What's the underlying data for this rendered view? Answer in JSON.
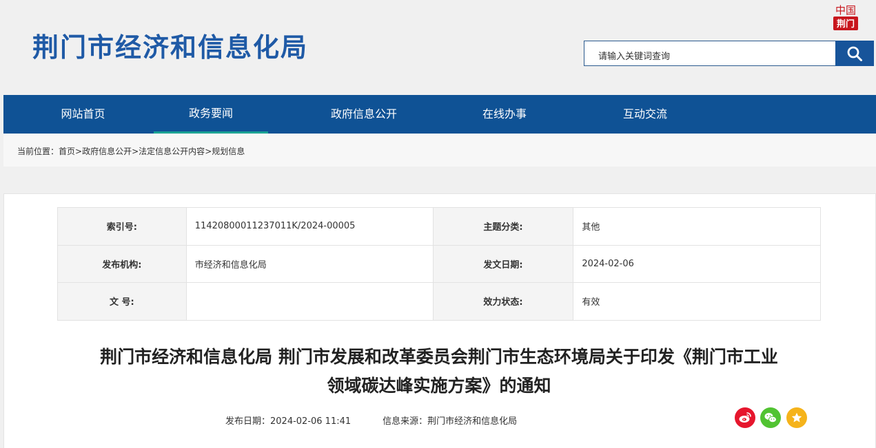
{
  "header": {
    "site_title": "荆门市经济和信息化局",
    "seal": {
      "top_text": "中国",
      "bottom_text": "荆门"
    },
    "search": {
      "placeholder": "请输入关键词查询"
    }
  },
  "nav": {
    "items": [
      {
        "label": "网站首页"
      },
      {
        "label": "政务要闻"
      },
      {
        "label": "政府信息公开"
      },
      {
        "label": "在线办事"
      },
      {
        "label": "互动交流"
      }
    ],
    "active_index": 1
  },
  "breadcrumb": {
    "prefix": "当前位置：",
    "items": [
      "首页",
      "政府信息公开",
      "法定信息公开内容",
      "规划信息"
    ],
    "separator": ">"
  },
  "meta": {
    "index_label": "索引号:",
    "index_value": "11420800011237011K/2024-00005",
    "topic_label": "主题分类:",
    "topic_value": "其他",
    "org_label": "发布机构:",
    "org_value": "市经济和信息化局",
    "date_label": "发文日期:",
    "date_value": "2024-02-06",
    "docno_label": "文 号:",
    "docno_value": "",
    "status_label": "效力状态:",
    "status_value": "有效"
  },
  "article": {
    "title_line1": "荆门市经济和信息化局 荆门市发展和改革委员会荆门市生态环境局关于印发《荆门市工业",
    "title_line2": "领域碳达峰实施方案》的通知",
    "publish_date": "发布日期：2024-02-06 11:41",
    "source": "信息来源：荆门市经济和信息化局"
  },
  "share": [
    {
      "icon": "weibo-icon",
      "color": "#e6162d"
    },
    {
      "icon": "wechat-icon",
      "color": "#51c332"
    },
    {
      "icon": "favorite-star-icon",
      "color": "#f5b31b"
    }
  ],
  "colors": {
    "brand_blue": "#1f5aa6",
    "nav_blue": "#0f5295",
    "nav_active_underline": "#1aa394"
  }
}
